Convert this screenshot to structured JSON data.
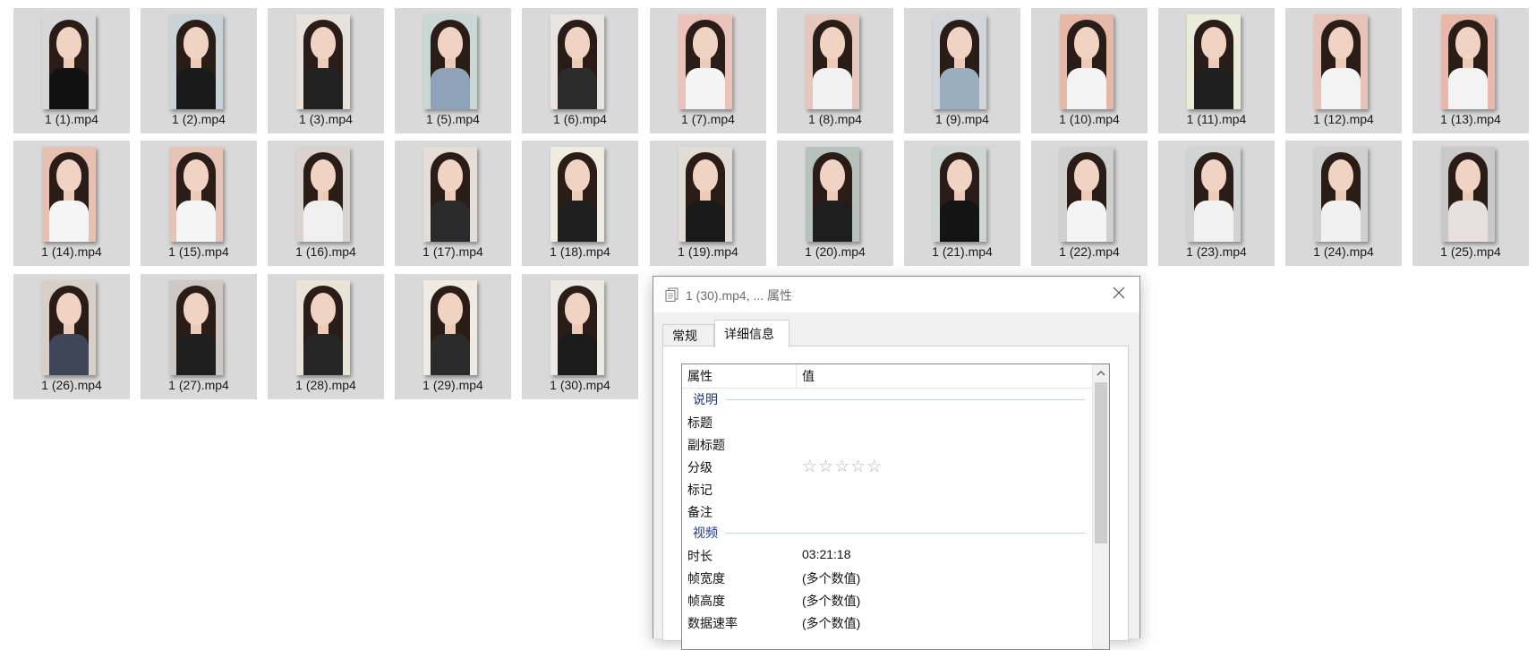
{
  "files": [
    {
      "label": "1 (1).mp4",
      "bg": "#d7d7d7",
      "top": "#111111"
    },
    {
      "label": "1 (2).mp4",
      "bg": "#c9d2d7",
      "top": "#1a1a1a"
    },
    {
      "label": "1 (3).mp4",
      "bg": "#e9e2dc",
      "top": "#222222"
    },
    {
      "label": "1 (5).mp4",
      "bg": "#c9d8d6",
      "top": "#8fa3b8"
    },
    {
      "label": "1 (6).mp4",
      "bg": "#e8e4e0",
      "top": "#2c2c2c"
    },
    {
      "label": "1 (7).mp4",
      "bg": "#eac3ba",
      "top": "#f4f4f4"
    },
    {
      "label": "1 (8).mp4",
      "bg": "#e6c7bd",
      "top": "#f2f2f2"
    },
    {
      "label": "1 (9).mp4",
      "bg": "#d1d6da",
      "top": "#9aaec0"
    },
    {
      "label": "1 (10).mp4",
      "bg": "#e5b8a8",
      "top": "#f3f3f3"
    },
    {
      "label": "1 (11).mp4",
      "bg": "#e9ecd8",
      "top": "#1f1f1f"
    },
    {
      "label": "1 (12).mp4",
      "bg": "#e7c2b6",
      "top": "#f3f3f3"
    },
    {
      "label": "1 (13).mp4",
      "bg": "#e6b9ab",
      "top": "#f3f3f3"
    },
    {
      "label": "1 (14).mp4",
      "bg": "#e8c0b2",
      "top": "#f5f5f5"
    },
    {
      "label": "1 (15).mp4",
      "bg": "#e8c4b8",
      "top": "#f5f5f5"
    },
    {
      "label": "1 (16).mp4",
      "bg": "#d9d2cf",
      "top": "#f0f0f0"
    },
    {
      "label": "1 (17).mp4",
      "bg": "#e4ded7",
      "top": "#2a2a2a"
    },
    {
      "label": "1 (18).mp4",
      "bg": "#f1ece2",
      "top": "#1f1f1f"
    },
    {
      "label": "1 (19).mp4",
      "bg": "#e2dcd7",
      "top": "#1a1a1a"
    },
    {
      "label": "1 (20).mp4",
      "bg": "#b8c2bd",
      "top": "#1e1e1e"
    },
    {
      "label": "1 (21).mp4",
      "bg": "#cfd5d2",
      "top": "#141414"
    },
    {
      "label": "1 (22).mp4",
      "bg": "#cfcfcf",
      "top": "#f4f4f4"
    },
    {
      "label": "1 (23).mp4",
      "bg": "#d2d3d3",
      "top": "#f2f2f2"
    },
    {
      "label": "1 (24).mp4",
      "bg": "#cfd1d1",
      "top": "#f1f1f1"
    },
    {
      "label": "1 (25).mp4",
      "bg": "#c9c9c9",
      "top": "#e8e0dd"
    },
    {
      "label": "1 (26).mp4",
      "bg": "#d8d0c8",
      "top": "#3e4658"
    },
    {
      "label": "1 (27).mp4",
      "bg": "#cfc7c3",
      "top": "#1f1f1f"
    },
    {
      "label": "1 (28).mp4",
      "bg": "#eae3d8",
      "top": "#262626"
    },
    {
      "label": "1 (29).mp4",
      "bg": "#f0ebe2",
      "top": "#2b2b2b"
    },
    {
      "label": "1 (30).mp4",
      "bg": "#ece8e2",
      "top": "#1b1b1b"
    }
  ],
  "dialog": {
    "title": "1 (30).mp4, ... 属性",
    "tabs": [
      "常规",
      "详细信息"
    ],
    "active_tab": "详细信息",
    "columns": {
      "property": "属性",
      "value": "值"
    },
    "sections": [
      {
        "group": "说明",
        "rows": [
          {
            "key": "标题",
            "value": ""
          },
          {
            "key": "副标题",
            "value": ""
          },
          {
            "key": "分级",
            "value": "",
            "stars": "☆☆☆☆☆",
            "rating": 0
          },
          {
            "key": "标记",
            "value": ""
          },
          {
            "key": "备注",
            "value": ""
          }
        ]
      },
      {
        "group": "视频",
        "rows": [
          {
            "key": "时长",
            "value": "03:21:18"
          },
          {
            "key": "帧宽度",
            "value": "(多个数值)"
          },
          {
            "key": "帧高度",
            "value": "(多个数值)"
          },
          {
            "key": "数据速率",
            "value": "(多个数值)"
          }
        ]
      }
    ]
  },
  "icons": {
    "title": "properties-icon",
    "close": "close-icon",
    "scroll_up": "chevron-up-icon"
  }
}
